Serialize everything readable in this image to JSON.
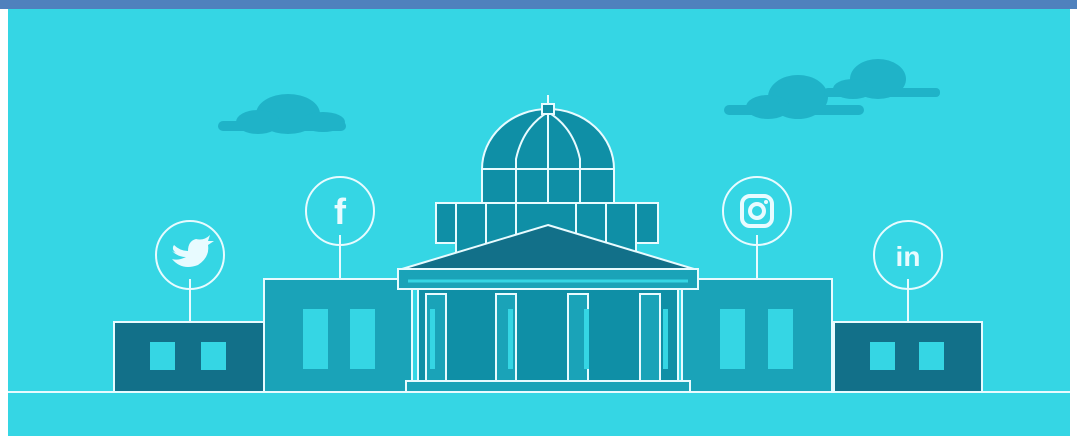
{
  "colors": {
    "frame_border": "#4f81bd",
    "sky": "#35d6e4",
    "cloud": "#1fb3c8",
    "building_dark": "#127089",
    "building_mid": "#1aa3b8",
    "building_light": "#0f8fa6",
    "outline": "#e8fbff"
  },
  "scene": {
    "description_icons": [
      "twitter-icon",
      "facebook-icon",
      "instagram-icon",
      "linkedin-icon"
    ],
    "facebook_glyph": "f",
    "linkedin_glyph": "in"
  }
}
